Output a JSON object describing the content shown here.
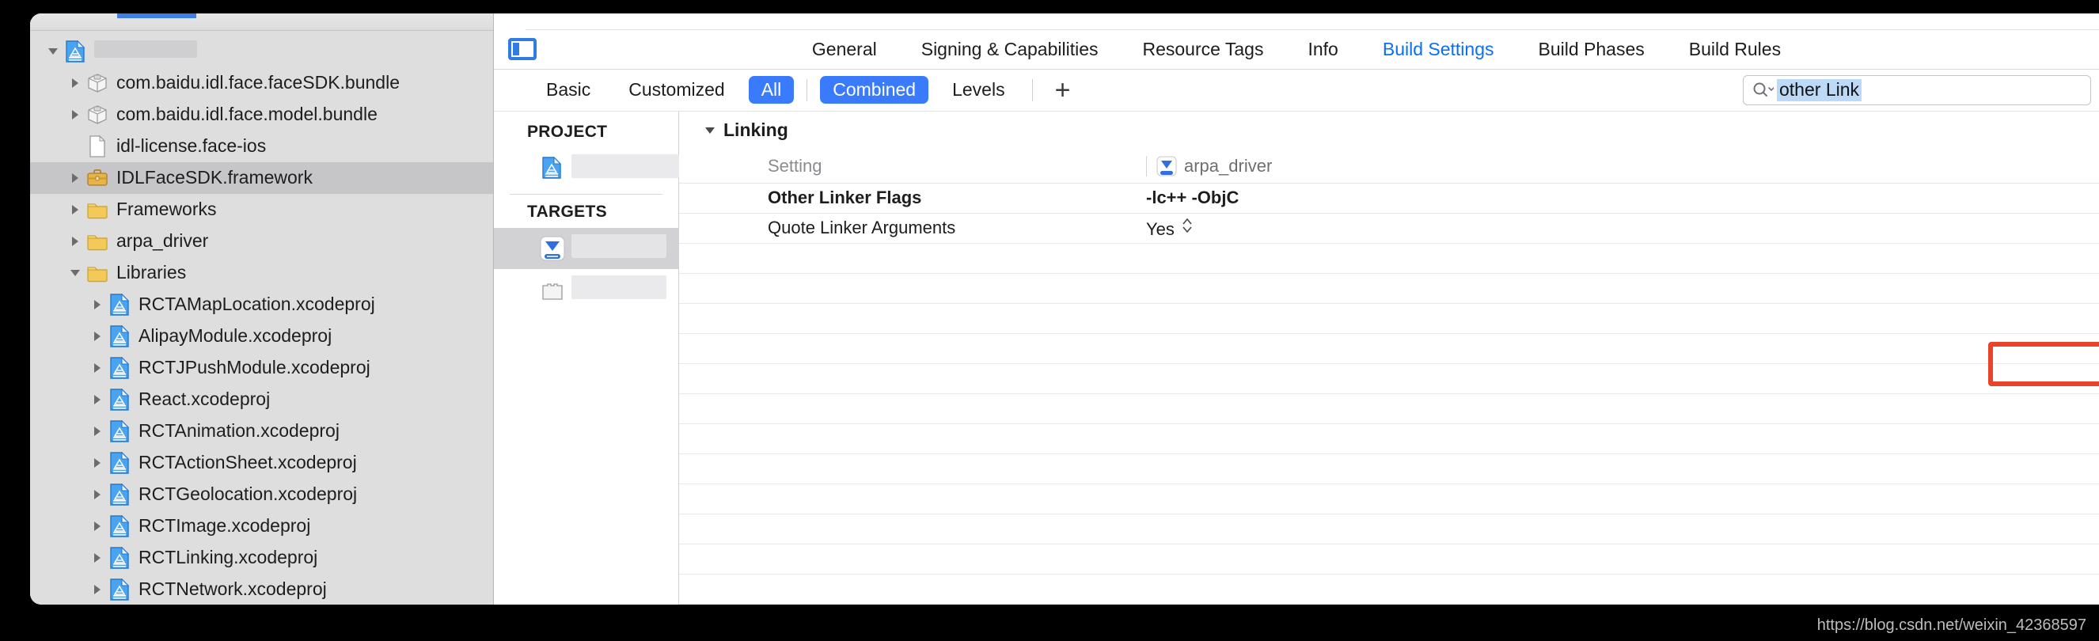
{
  "window": {
    "title_redacted": true
  },
  "navigator": {
    "items": [
      {
        "label": "",
        "redacted": true,
        "redact_width": 130,
        "icon": "xcode-project-icon",
        "depth": 0,
        "twisty": "down",
        "selected": false
      },
      {
        "label": "com.baidu.idl.face.faceSDK.bundle",
        "icon": "bundle-icon",
        "depth": 1,
        "twisty": "right",
        "selected": false
      },
      {
        "label": "com.baidu.idl.face.model.bundle",
        "icon": "bundle-icon",
        "depth": 1,
        "twisty": "right",
        "selected": false
      },
      {
        "label": "idl-license.face-ios",
        "icon": "file-icon",
        "depth": 1,
        "twisty": "none",
        "selected": false
      },
      {
        "label": "IDLFaceSDK.framework",
        "icon": "framework-icon",
        "depth": 1,
        "twisty": "right",
        "selected": true
      },
      {
        "label": "Frameworks",
        "icon": "folder-icon",
        "depth": 1,
        "twisty": "right",
        "selected": false
      },
      {
        "label": "arpa_driver",
        "icon": "folder-icon",
        "depth": 1,
        "twisty": "right",
        "selected": false
      },
      {
        "label": "Libraries",
        "icon": "folder-icon",
        "depth": 1,
        "twisty": "down",
        "selected": false
      },
      {
        "label": "RCTAMapLocation.xcodeproj",
        "icon": "xcode-project-icon",
        "depth": 2,
        "twisty": "right",
        "selected": false
      },
      {
        "label": "AlipayModule.xcodeproj",
        "icon": "xcode-project-icon",
        "depth": 2,
        "twisty": "right",
        "selected": false
      },
      {
        "label": "RCTJPushModule.xcodeproj",
        "icon": "xcode-project-icon",
        "depth": 2,
        "twisty": "right",
        "selected": false
      },
      {
        "label": "React.xcodeproj",
        "icon": "xcode-project-icon",
        "depth": 2,
        "twisty": "right",
        "selected": false
      },
      {
        "label": "RCTAnimation.xcodeproj",
        "icon": "xcode-project-icon",
        "depth": 2,
        "twisty": "right",
        "selected": false
      },
      {
        "label": "RCTActionSheet.xcodeproj",
        "icon": "xcode-project-icon",
        "depth": 2,
        "twisty": "right",
        "selected": false
      },
      {
        "label": "RCTGeolocation.xcodeproj",
        "icon": "xcode-project-icon",
        "depth": 2,
        "twisty": "right",
        "selected": false
      },
      {
        "label": "RCTImage.xcodeproj",
        "icon": "xcode-project-icon",
        "depth": 2,
        "twisty": "right",
        "selected": false
      },
      {
        "label": "RCTLinking.xcodeproj",
        "icon": "xcode-project-icon",
        "depth": 2,
        "twisty": "right",
        "selected": false
      },
      {
        "label": "RCTNetwork.xcodeproj",
        "icon": "xcode-project-icon",
        "depth": 2,
        "twisty": "right",
        "selected": false
      }
    ]
  },
  "editor": {
    "panel_toggle_icon": "show-navigator-icon",
    "tabs": [
      {
        "label": "General",
        "active": false
      },
      {
        "label": "Signing & Capabilities",
        "active": false
      },
      {
        "label": "Resource Tags",
        "active": false
      },
      {
        "label": "Info",
        "active": false
      },
      {
        "label": "Build Settings",
        "active": true
      },
      {
        "label": "Build Phases",
        "active": false
      },
      {
        "label": "Build Rules",
        "active": false
      }
    ],
    "filterbar": {
      "items": [
        {
          "label": "Basic",
          "on": false
        },
        {
          "label": "Customized",
          "on": false
        },
        {
          "label": "All",
          "on": true
        },
        {
          "label": "Combined",
          "on": true
        },
        {
          "label": "Levels",
          "on": false
        }
      ],
      "add_label": "+"
    },
    "search": {
      "icon": "search-icon",
      "value": "other Link",
      "placeholder": "Search",
      "selected_highlight": "#bcd9f7"
    }
  },
  "project_pane": {
    "project_header": "PROJECT",
    "project_items": [
      {
        "label": "",
        "redacted": true,
        "redact_width": 136,
        "icon": "xcode-project-icon",
        "selected": false
      }
    ],
    "targets_header": "TARGETS",
    "target_items": [
      {
        "label": "",
        "redacted": true,
        "redact_width": 120,
        "icon": "app-target-icon",
        "selected": true
      },
      {
        "label": "",
        "redacted": true,
        "redact_width": 120,
        "icon": "bundle-target-icon",
        "selected": false
      }
    ]
  },
  "build_settings": {
    "section": {
      "label": "Linking",
      "expanded": true,
      "caret_icon": "caret-down-icon"
    },
    "columns": {
      "setting_header": "Setting",
      "target_header": "arpa_driver",
      "target_icon": "app-target-icon"
    },
    "rows": [
      {
        "name": "Other Linker Flags",
        "value": "-lc++ -ObjC",
        "bold": true,
        "highlighted": true,
        "stepper": false
      },
      {
        "name": "Quote Linker Arguments",
        "value": "Yes",
        "bold": false,
        "highlighted": false,
        "stepper": true
      }
    ],
    "empty_row_count": 13,
    "highlight_color": "#e8442a"
  },
  "watermark": {
    "text": "https://blog.csdn.net/weixin_42368597"
  }
}
